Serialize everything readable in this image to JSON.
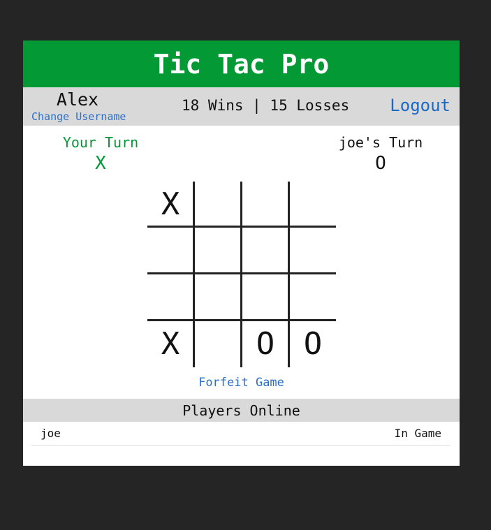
{
  "header": {
    "title": "Tic Tac Pro"
  },
  "user": {
    "name": "Alex",
    "change_label": "Change Username",
    "record": "18 Wins | 15 Losses",
    "logout_label": "Logout"
  },
  "turns": {
    "player": {
      "label": "Your Turn",
      "mark": "X"
    },
    "opponent": {
      "label": "joe's Turn",
      "mark": "O"
    }
  },
  "board": {
    "cells": [
      "X",
      "",
      "",
      "",
      "",
      "",
      "",
      "",
      "",
      "",
      "",
      "",
      "X",
      "",
      "O",
      "O"
    ]
  },
  "game": {
    "forfeit_label": "Forfeit Game"
  },
  "players": {
    "title": "Players Online",
    "list": [
      {
        "name": "joe",
        "status": "In Game"
      }
    ]
  },
  "colors": {
    "brand": "#039a35",
    "link": "#2e6fc7",
    "background": "#252525"
  }
}
